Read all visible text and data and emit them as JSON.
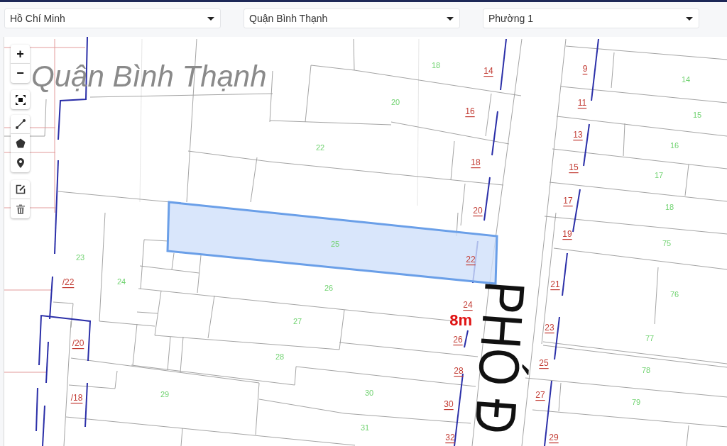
{
  "filters": [
    {
      "value": "Hồ Chí Minh"
    },
    {
      "value": "Quận Bình Thạnh"
    },
    {
      "value": "Phường 1"
    }
  ],
  "map_controls": {
    "zoom_in": "+",
    "zoom_out": "−"
  },
  "map": {
    "area_label": "Quận Bình Thạnh",
    "street_label": "PHÓ Đ",
    "road_width": "8m",
    "parcels": [
      {
        "number": "18",
        "selected": false
      },
      {
        "number": "14",
        "selected": false
      },
      {
        "number": "20",
        "selected": false
      },
      {
        "number": "15",
        "selected": false
      },
      {
        "number": "16",
        "selected": false
      },
      {
        "number": "22",
        "selected": false
      },
      {
        "number": "17",
        "selected": false
      },
      {
        "number": "18",
        "selected": false
      },
      {
        "number": "25",
        "selected": true
      },
      {
        "number": "75",
        "selected": false
      },
      {
        "number": "23",
        "selected": false
      },
      {
        "number": "24",
        "selected": false
      },
      {
        "number": "26",
        "selected": false
      },
      {
        "number": "76",
        "selected": false
      },
      {
        "number": "27",
        "selected": false
      },
      {
        "number": "77",
        "selected": false
      },
      {
        "number": "28",
        "selected": false
      },
      {
        "number": "78",
        "selected": false
      },
      {
        "number": "30",
        "selected": false
      },
      {
        "number": "29",
        "selected": false
      },
      {
        "number": "79",
        "selected": false
      },
      {
        "number": "31",
        "selected": false
      }
    ],
    "house_numbers": [
      "9",
      "14",
      "11",
      "16",
      "13",
      "18",
      "15",
      "17",
      "20",
      "19",
      "22",
      "/22",
      "21",
      "24",
      "23",
      "26",
      "/20",
      "25",
      "28",
      "27",
      "/18",
      "30",
      "32",
      "29"
    ]
  }
}
